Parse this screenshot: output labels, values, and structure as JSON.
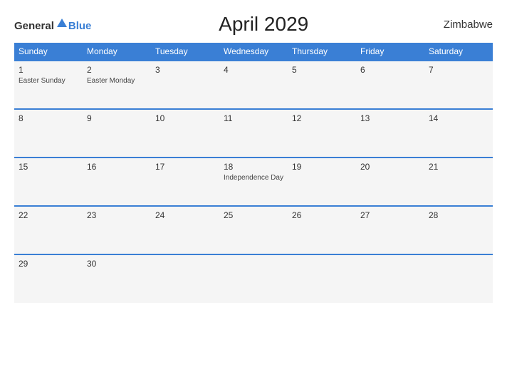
{
  "header": {
    "logo_general": "General",
    "logo_blue": "Blue",
    "title": "April 2029",
    "country": "Zimbabwe"
  },
  "weekdays": [
    "Sunday",
    "Monday",
    "Tuesday",
    "Wednesday",
    "Thursday",
    "Friday",
    "Saturday"
  ],
  "weeks": [
    [
      {
        "day": "1",
        "holiday": "Easter Sunday"
      },
      {
        "day": "2",
        "holiday": "Easter Monday"
      },
      {
        "day": "3",
        "holiday": ""
      },
      {
        "day": "4",
        "holiday": ""
      },
      {
        "day": "5",
        "holiday": ""
      },
      {
        "day": "6",
        "holiday": ""
      },
      {
        "day": "7",
        "holiday": ""
      }
    ],
    [
      {
        "day": "8",
        "holiday": ""
      },
      {
        "day": "9",
        "holiday": ""
      },
      {
        "day": "10",
        "holiday": ""
      },
      {
        "day": "11",
        "holiday": ""
      },
      {
        "day": "12",
        "holiday": ""
      },
      {
        "day": "13",
        "holiday": ""
      },
      {
        "day": "14",
        "holiday": ""
      }
    ],
    [
      {
        "day": "15",
        "holiday": ""
      },
      {
        "day": "16",
        "holiday": ""
      },
      {
        "day": "17",
        "holiday": ""
      },
      {
        "day": "18",
        "holiday": "Independence Day"
      },
      {
        "day": "19",
        "holiday": ""
      },
      {
        "day": "20",
        "holiday": ""
      },
      {
        "day": "21",
        "holiday": ""
      }
    ],
    [
      {
        "day": "22",
        "holiday": ""
      },
      {
        "day": "23",
        "holiday": ""
      },
      {
        "day": "24",
        "holiday": ""
      },
      {
        "day": "25",
        "holiday": ""
      },
      {
        "day": "26",
        "holiday": ""
      },
      {
        "day": "27",
        "holiday": ""
      },
      {
        "day": "28",
        "holiday": ""
      }
    ],
    [
      {
        "day": "29",
        "holiday": ""
      },
      {
        "day": "30",
        "holiday": ""
      },
      {
        "day": "",
        "holiday": ""
      },
      {
        "day": "",
        "holiday": ""
      },
      {
        "day": "",
        "holiday": ""
      },
      {
        "day": "",
        "holiday": ""
      },
      {
        "day": "",
        "holiday": ""
      }
    ]
  ]
}
